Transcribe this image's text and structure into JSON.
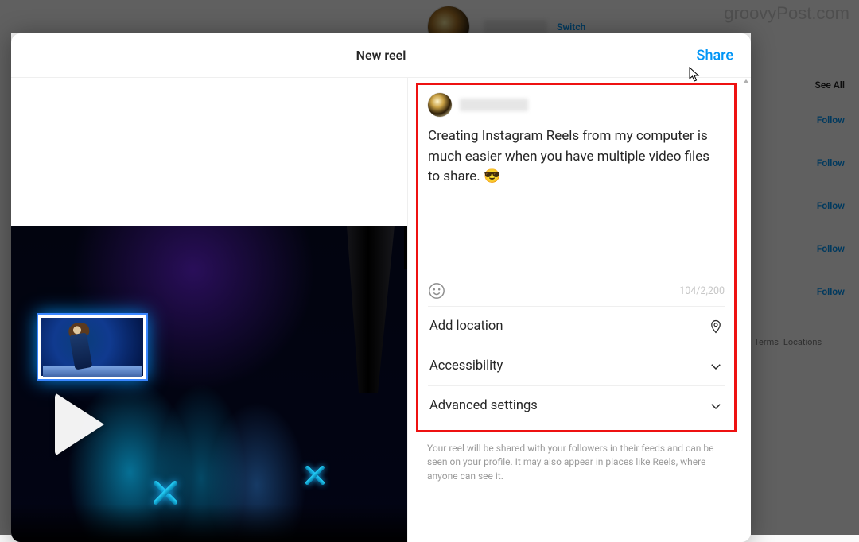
{
  "watermark": "groovyPost.com",
  "background": {
    "switch": "Switch",
    "see_all": "See All",
    "follow": "Follow",
    "footer_links": [
      "Terms",
      "Locations"
    ]
  },
  "modal": {
    "title": "New reel",
    "share": "Share"
  },
  "caption": {
    "text": "Creating Instagram Reels from my computer is much easier when you have multiple video files to share. ",
    "emoji": "😎",
    "counter": "104/2,200"
  },
  "rows": {
    "location": "Add location",
    "accessibility": "Accessibility",
    "advanced": "Advanced settings"
  },
  "disclaimer": "Your reel will be shared with your followers in their feeds and can be seen on your profile. It may also appear in places like Reels, where anyone can see it."
}
